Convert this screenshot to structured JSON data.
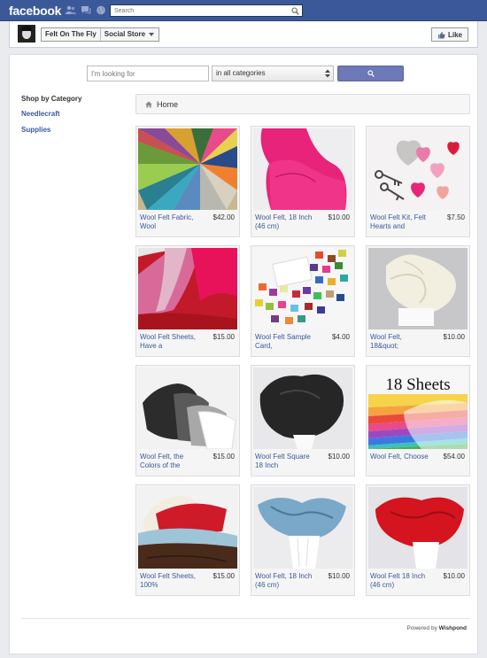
{
  "facebook": {
    "logo": "facebook",
    "search_placeholder": "Search",
    "brand_color": "#3b5998"
  },
  "page_header": {
    "page_name": "Felt On The Fly",
    "tab_name": "Social Store",
    "like_label": "Like"
  },
  "store_search": {
    "query_placeholder": "I'm looking for",
    "category_value": "in all categories",
    "button_color": "#6d78b6"
  },
  "sidebar": {
    "heading": "Shop by Category",
    "categories": [
      "Needlecraft",
      "Supplies"
    ]
  },
  "breadcrumb": {
    "home_label": "Home"
  },
  "products": [
    {
      "title": "Wool Felt Fabric, Wool",
      "price": "$42.00"
    },
    {
      "title": "Wool Felt, 18 Inch (46 cm)",
      "price": "$10.00"
    },
    {
      "title": "Wool Felt Kit, Felt Hearts and",
      "price": "$7.50"
    },
    {
      "title": "Wool Felt Sheets, Have a",
      "price": "$15.00"
    },
    {
      "title": "Wool Felt Sample Card,",
      "price": "$4.00"
    },
    {
      "title": "Wool Felt, 18&quot;",
      "price": "$10.00"
    },
    {
      "title": "Wool Felt, the Colors of the",
      "price": "$15.00"
    },
    {
      "title": "Wool Felt Square 18 Inch",
      "price": "$10.00"
    },
    {
      "title": "Wool Felt, Choose",
      "price": "$54.00"
    },
    {
      "title": "Wool Felt Sheets, 100%",
      "price": "$15.00"
    },
    {
      "title": "Wool Felt, 18 Inch (46 cm)",
      "price": "$10.00"
    },
    {
      "title": "Wool Felt 18 Inch (46 cm)",
      "price": "$10.00"
    }
  ],
  "product_image_text": {
    "sheets_overlay": "18 Sheets"
  },
  "footer": {
    "powered_by": "Powered by",
    "provider": "Wishpond"
  }
}
